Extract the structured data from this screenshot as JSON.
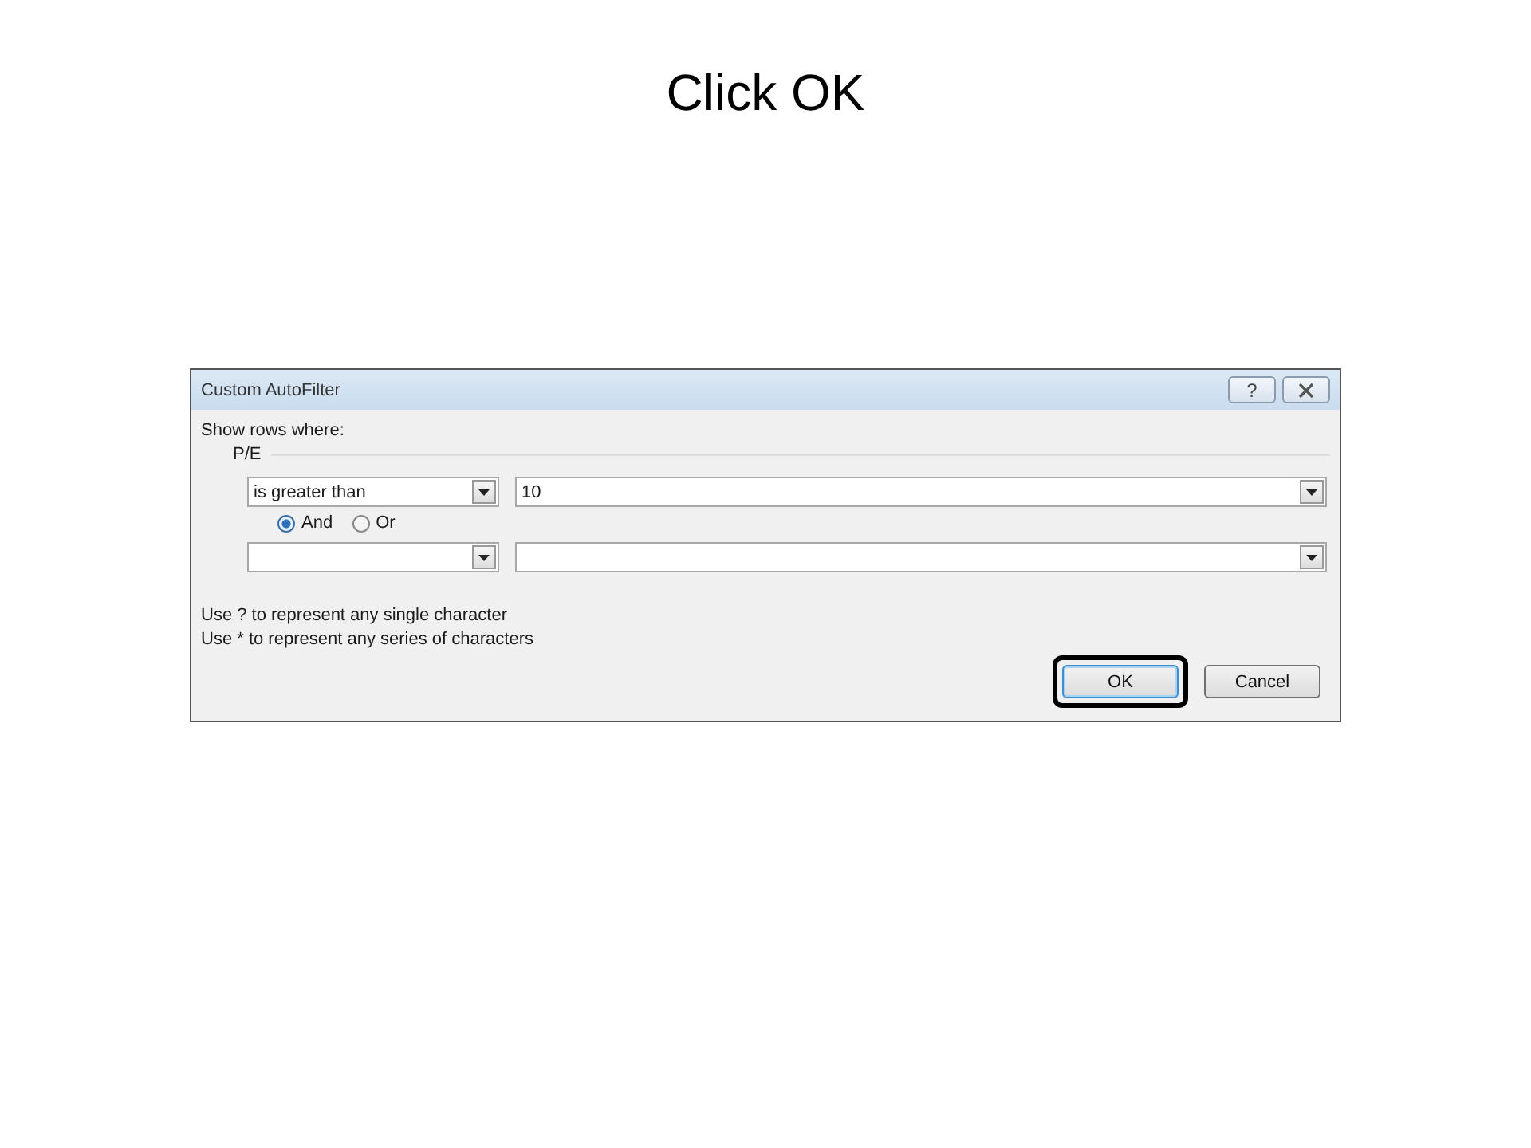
{
  "slide": {
    "title": "Click OK"
  },
  "dialog": {
    "title": "Custom AutoFilter",
    "help_button": "?",
    "prompt": "Show rows where:",
    "field": "P/E",
    "conditions": [
      {
        "operator": "is greater than",
        "value": "10"
      }
    ],
    "join": [
      {
        "label": "And",
        "selected": true
      },
      {
        "label": "Or",
        "selected": false
      }
    ],
    "hints": [
      "Use ? to represent any single character",
      "Use * to represent any series of characters"
    ],
    "buttons": [
      {
        "label": "OK",
        "default": true,
        "highlighted": true
      },
      {
        "label": "Cancel",
        "default": false,
        "highlighted": false
      }
    ]
  }
}
